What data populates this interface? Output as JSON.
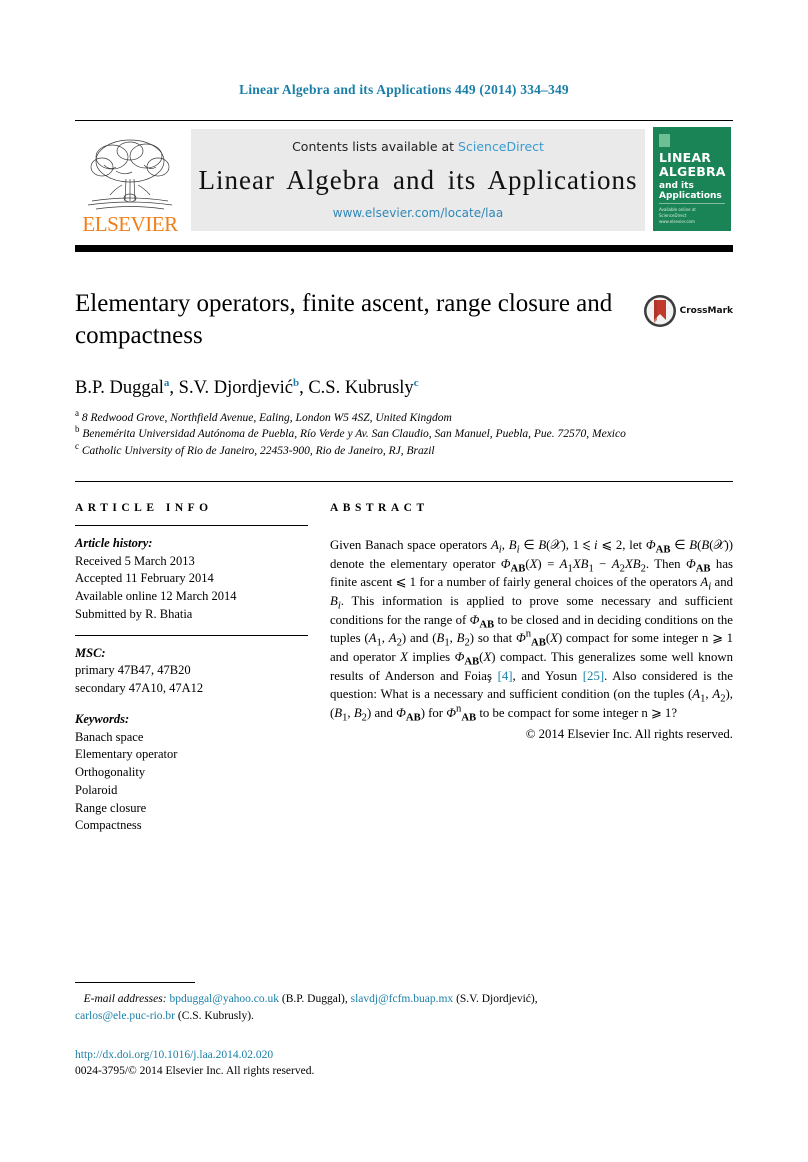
{
  "running_head": "Linear Algebra and its Applications 449 (2014) 334–349",
  "masthead": {
    "contents_prefix": "Contents lists available at",
    "sciencedirect": "ScienceDirect",
    "journal_title": "Linear Algebra and its Applications",
    "journal_url": "www.elsevier.com/locate/laa",
    "publisher_name": "ELSEVIER",
    "cover": {
      "line1": "LINEAR",
      "line2": "ALGEBRA",
      "line3": "and its\nApplications",
      "footer_note": "Available online at\nScienceDirect\nwww.elsevier.com/locate/laa"
    }
  },
  "article": {
    "title": "Elementary operators, finite ascent, range closure and compactness",
    "crossmark_label": "CrossMark",
    "authors": "B.P. Duggal ᵃ, S.V. Djordjević ᵇ, C.S. Kubrusly ᶜ",
    "affiliations": [
      "8 Redwood Grove, Northfield Avenue, Ealing, London W5 4SZ, United Kingdom",
      "Benemérita Universidad Autónoma de Puebla, Río Verde y Av. San Claudio, San Manuel, Puebla, Pue. 72570, Mexico",
      "Catholic University of Rio de Janeiro, 22453-900, Rio de Janeiro, RJ, Brazil"
    ]
  },
  "article_info": {
    "heading": "ARTICLE INFO",
    "history_label": "Article history:",
    "history": [
      "Received 5 March 2013",
      "Accepted 11 February 2014",
      "Available online 12 March 2014",
      "Submitted by R. Bhatia"
    ],
    "msc_label": "MSC:",
    "msc": [
      "primary 47B47, 47B20",
      "secondary 47A10, 47A12"
    ],
    "keywords_label": "Keywords:",
    "keywords": [
      "Banach space",
      "Elementary operator",
      "Orthogonality",
      "Polaroid",
      "Range closure",
      "Compactness"
    ]
  },
  "abstract": {
    "heading": "ABSTRACT",
    "text_part1": "Given Banach space operators A",
    "full_text": "Given Banach space operators Aᵢ, Bᵢ ∈ B(X), 1 ⩽ i ⩽ 2, let ΦAB ∈ B(B(X)) denote the elementary operator ΦAB(X) = A₁XB₁ − A₂XB₂. Then ΦAB has finite ascent ⩽ 1 for a number of fairly general choices of the operators Aᵢ and Bᵢ. This information is applied to prove some necessary and sufficient conditions for the range of ΦAB to be closed and in deciding conditions on the tuples (A₁, A₂) and (B₁, B₂) so that ΦⁿAB(X) compact for some integer n ⩾ 1 and operator X implies ΦAB(X) compact. This generalizes some well known results of Anderson and Foiaş [4], and Yosun [25]. Also considered is the question: What is a necessary and sufficient condition (on the tuples (A₁, A₂), (B₁, B₂) and ΦAB) for ΦⁿAB to be compact for some integer n ⩾ 1?",
    "citation_1": "[4]",
    "citation_2": "[25]",
    "copyright": "© 2014 Elsevier Inc. All rights reserved."
  },
  "footer": {
    "email_label": "E-mail addresses:",
    "emails": [
      {
        "address": "bpduggal@yahoo.co.uk",
        "owner": "(B.P. Duggal)"
      },
      {
        "address": "slavdj@fcfm.buap.mx",
        "owner": "(S.V. Djordjević)"
      },
      {
        "address": "carlos@ele.puc-rio.br",
        "owner": "(C.S. Kubrusly)"
      }
    ],
    "doi": "http://dx.doi.org/10.1016/j.laa.2014.02.020",
    "issn_line": "0024-3795/© 2014 Elsevier Inc. All rights reserved."
  },
  "colors": {
    "link_blue": "#1a7fa8",
    "sciencedirect_blue": "#3a9bd0",
    "elsevier_orange": "#F07F1A",
    "cover_green": "#1b8457"
  }
}
